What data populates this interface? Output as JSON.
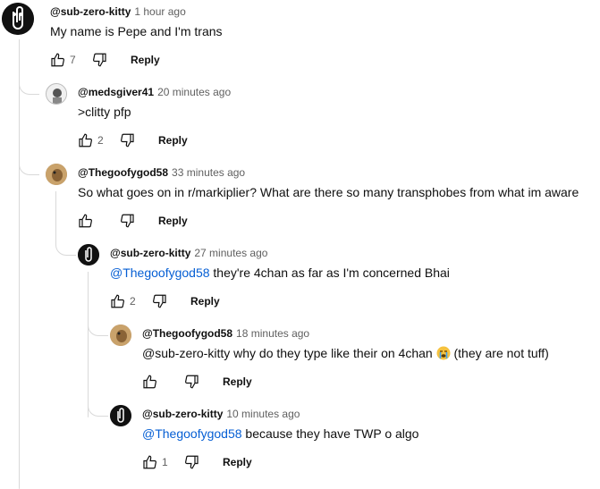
{
  "comments": [
    {
      "author": "@sub-zero-kitty",
      "time": "1 hour ago",
      "text": "My name is Pepe and I'm trans",
      "likes": "7",
      "reply": "Reply"
    },
    {
      "author": "@medsgiver41",
      "time": "20 minutes ago",
      "text": ">clitty pfp",
      "likes": "2",
      "reply": "Reply"
    },
    {
      "author": "@Thegoofygod58",
      "time": "33 minutes ago",
      "text": "So what goes on in r/markiplier? What are there so many transphobes from what im aware",
      "likes": "",
      "reply": "Reply"
    },
    {
      "author": "@sub-zero-kitty",
      "time": "27 minutes ago",
      "mention": "@Thegoofygod58",
      "text": " they're 4chan as far as I'm concerned Bhai",
      "likes": "2",
      "reply": "Reply"
    },
    {
      "author": "@Thegoofygod58",
      "time": "18 minutes ago",
      "text": "@sub-zero-kitty why do they type like their on 4chan",
      "text_after": " (they are not tuff)",
      "emoji": "loudly-crying-face",
      "likes": "",
      "reply": "Reply"
    },
    {
      "author": "@sub-zero-kitty",
      "time": "10 minutes ago",
      "mention": "@Thegoofygod58",
      "text": " because they have TWP o algo",
      "likes": "1",
      "reply": "Reply"
    }
  ]
}
